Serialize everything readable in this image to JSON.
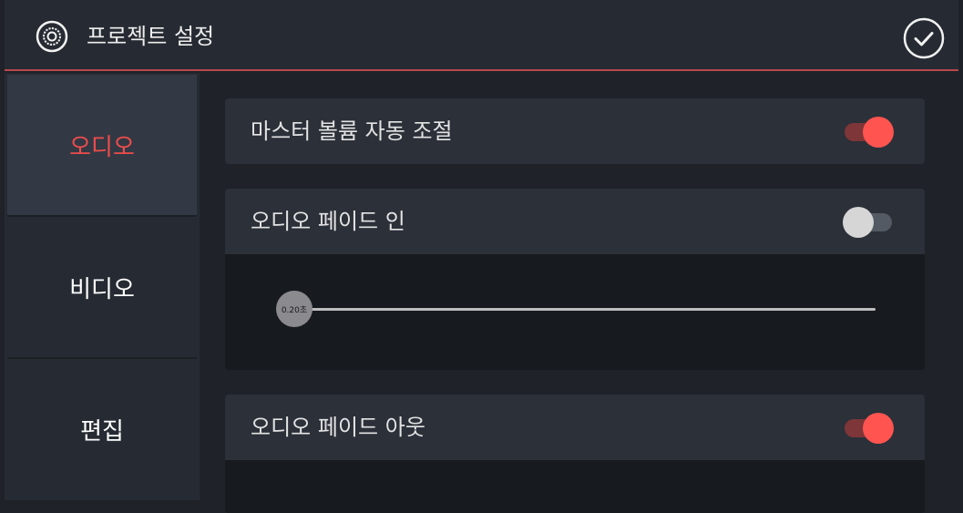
{
  "header": {
    "title": "프로젝트 설정",
    "gear_icon": "gear-icon",
    "confirm_icon": "check-circle-icon"
  },
  "sidebar": {
    "items": [
      {
        "label": "오디오",
        "active": true
      },
      {
        "label": "비디오",
        "active": false
      },
      {
        "label": "편집",
        "active": false
      }
    ]
  },
  "settings": {
    "master_volume": {
      "label": "마스터 볼륨 자동 조절",
      "on": true
    },
    "fade_in": {
      "label": "오디오 페이드 인",
      "on": false,
      "slider_value": "0.20초",
      "slider_fraction": 0.0
    },
    "fade_out": {
      "label": "오디오 페이드 아웃",
      "on": true
    }
  },
  "colors": {
    "accent": "#ff5450",
    "header_border": "#b8474a",
    "panel": "#2b3039",
    "background": "#1f2228"
  }
}
